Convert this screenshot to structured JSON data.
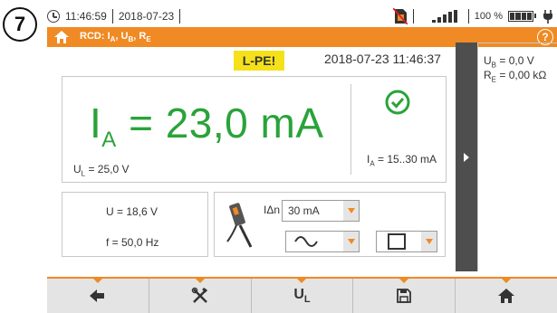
{
  "step_marker": "7",
  "status": {
    "time": "11:46:59",
    "date": "2018-07-23",
    "battery_percent": "100 %",
    "icons": [
      "clock-icon",
      "sim-card-icon",
      "signal-icon",
      "battery-icon",
      "power-plug-icon"
    ]
  },
  "title": {
    "rcd_prefix": "RCD: ",
    "ia_main": "I",
    "ia_sub": "A",
    "sep1": ", ",
    "ub_main": "U",
    "ub_sub": "B",
    "sep2": ", ",
    "re_main": "R",
    "re_sub": "E",
    "help_label": "?"
  },
  "measurement": {
    "warning_badge": "L-PE!",
    "timestamp": "2018-07-23 11:46:37",
    "main_symbol": "I",
    "main_sub": "A",
    "main_value_text": " = 23,0 mA",
    "ul_main": "U",
    "ul_sub": "L",
    "ul_value": " = 25,0 V",
    "range_main": "I",
    "range_sub": "A",
    "range_value": " = 15..30 mA",
    "voltage": "U = 18,6 V",
    "frequency": "f = 50,0 Hz",
    "idn_label": "IΔn",
    "idn_selected": "30 mA",
    "waveform_selected": "sine-wave-icon",
    "shape_selected": "square-wave-icon"
  },
  "side_panel": {
    "ub_main": "U",
    "ub_sub": "B",
    "ub_value": " = 0,0 V",
    "re_main": "R",
    "re_sub": "E",
    "re_value": " = 0,00 kΩ"
  },
  "toolbar": {
    "buttons": [
      "back-arrow-icon",
      "settings-tools-icon",
      "UL",
      "save-icon",
      "home-icon"
    ],
    "ul_main": "U",
    "ul_sub": "L"
  },
  "colors": {
    "accent": "#f08a24",
    "measurement_green": "#2aa33a",
    "warning_yellow": "#f5e11a",
    "side_tab": "#4e4e4e"
  }
}
